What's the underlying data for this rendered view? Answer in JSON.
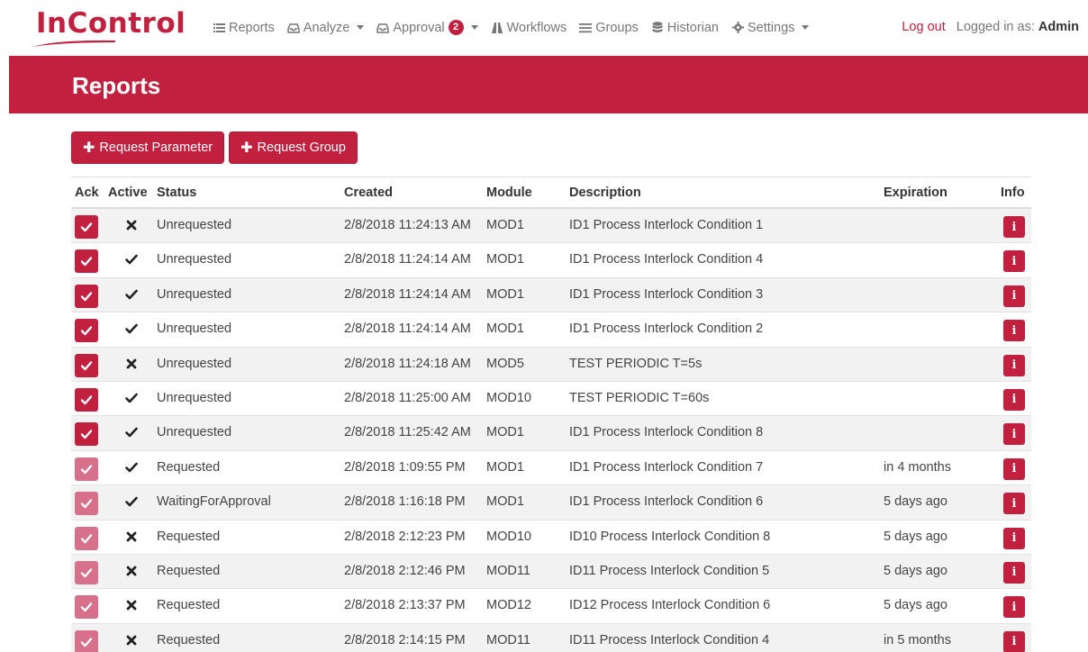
{
  "brand": {
    "name_part1": "In",
    "name_part2": "Control",
    "color": "#c1203f"
  },
  "nav": {
    "items": [
      {
        "label": "Reports",
        "icon": "list-icon",
        "has_caret": false
      },
      {
        "label": "Analyze",
        "icon": "inbox-icon",
        "has_caret": true
      },
      {
        "label": "Approval",
        "icon": "inbox-icon",
        "has_caret": true,
        "badge": "2"
      },
      {
        "label": "Workflows",
        "icon": "road-icon",
        "has_caret": false
      },
      {
        "label": "Groups",
        "icon": "menu-icon",
        "has_caret": false
      },
      {
        "label": "Historian",
        "icon": "database-icon",
        "has_caret": false
      },
      {
        "label": "Settings",
        "icon": "gear-icon",
        "has_caret": true
      }
    ],
    "logout_label": "Log out",
    "logged_in_prefix": "Logged in as:",
    "logged_in_user": "Admin"
  },
  "page": {
    "title": "Reports"
  },
  "toolbar": {
    "request_parameter_label": "Request Parameter",
    "request_group_label": "Request Group"
  },
  "table": {
    "headers": {
      "ack": "Ack",
      "active": "Active",
      "status": "Status",
      "created": "Created",
      "module": "Module",
      "description": "Description",
      "expiration": "Expiration",
      "info": "Info"
    },
    "rows": [
      {
        "acked": true,
        "active": false,
        "status": "Unrequested",
        "created": "2/8/2018 11:24:13 AM",
        "module": "MOD1",
        "description": "ID1 Process Interlock Condition 1",
        "expiration": ""
      },
      {
        "acked": true,
        "active": true,
        "status": "Unrequested",
        "created": "2/8/2018 11:24:14 AM",
        "module": "MOD1",
        "description": "ID1 Process Interlock Condition 4",
        "expiration": ""
      },
      {
        "acked": true,
        "active": true,
        "status": "Unrequested",
        "created": "2/8/2018 11:24:14 AM",
        "module": "MOD1",
        "description": "ID1 Process Interlock Condition 3",
        "expiration": ""
      },
      {
        "acked": true,
        "active": true,
        "status": "Unrequested",
        "created": "2/8/2018 11:24:14 AM",
        "module": "MOD1",
        "description": "ID1 Process Interlock Condition 2",
        "expiration": ""
      },
      {
        "acked": true,
        "active": false,
        "status": "Unrequested",
        "created": "2/8/2018 11:24:18 AM",
        "module": "MOD5",
        "description": "TEST PERIODIC T=5s",
        "expiration": ""
      },
      {
        "acked": true,
        "active": true,
        "status": "Unrequested",
        "created": "2/8/2018 11:25:00 AM",
        "module": "MOD10",
        "description": "TEST PERIODIC T=60s",
        "expiration": ""
      },
      {
        "acked": true,
        "active": true,
        "status": "Unrequested",
        "created": "2/8/2018 11:25:42 AM",
        "module": "MOD1",
        "description": "ID1 Process Interlock Condition 8",
        "expiration": ""
      },
      {
        "acked": false,
        "active": true,
        "status": "Requested",
        "created": "2/8/2018 1:09:55 PM",
        "module": "MOD1",
        "description": "ID1 Process Interlock Condition 7",
        "expiration": "in 4 months"
      },
      {
        "acked": false,
        "active": true,
        "status": "WaitingForApproval",
        "created": "2/8/2018 1:16:18 PM",
        "module": "MOD1",
        "description": "ID1 Process Interlock Condition 6",
        "expiration": "5 days ago"
      },
      {
        "acked": false,
        "active": false,
        "status": "Requested",
        "created": "2/8/2018 2:12:23 PM",
        "module": "MOD10",
        "description": "ID10 Process Interlock Condition 8",
        "expiration": "5 days ago"
      },
      {
        "acked": false,
        "active": false,
        "status": "Requested",
        "created": "2/8/2018 2:12:46 PM",
        "module": "MOD11",
        "description": "ID11 Process Interlock Condition 5",
        "expiration": "5 days ago"
      },
      {
        "acked": false,
        "active": false,
        "status": "Requested",
        "created": "2/8/2018 2:13:37 PM",
        "module": "MOD12",
        "description": "ID12 Process Interlock Condition 6",
        "expiration": "5 days ago"
      },
      {
        "acked": false,
        "active": false,
        "status": "Requested",
        "created": "2/8/2018 2:14:15 PM",
        "module": "MOD11",
        "description": "ID11 Process Interlock Condition 4",
        "expiration": "in 5 months"
      }
    ]
  }
}
